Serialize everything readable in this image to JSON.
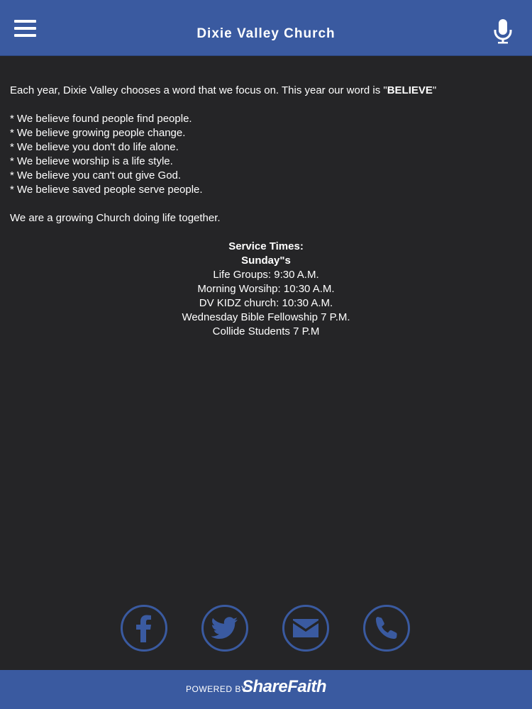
{
  "header": {
    "title": "Dixie Valley Church",
    "menu_icon": "hamburger-menu-icon",
    "mic_icon": "microphone-icon",
    "background_color": "#3a5aa0"
  },
  "content": {
    "intro_prefix": "Each year, Dixie Valley chooses a word that we focus on.  This year our word is \"",
    "intro_word": "BELIEVE",
    "intro_suffix": "\"",
    "beliefs": [
      "* We believe found people find people.",
      "* We believe growing people change.",
      "* We believe you don't do life alone.",
      "* We believe worship is a life style.",
      "* We believe you can't out give God.",
      "* We believe saved people serve people."
    ],
    "closing": "We are a growing Church doing life together."
  },
  "service": {
    "heading": "Service Times:",
    "day": "Sunday\"s",
    "times": [
      "Life Groups: 9:30 A.M.",
      "Morning Worsihp: 10:30 A.M.",
      "DV KIDZ church: 10:30 A.M.",
      "Wednesday Bible Fellowship 7 P.M.",
      "Collide Students 7 P.M"
    ]
  },
  "social": {
    "icons": [
      "facebook-icon",
      "twitter-icon",
      "email-icon",
      "phone-icon"
    ],
    "accent_color": "#3a5aa0"
  },
  "footer": {
    "powered_by": "POWERED BY",
    "brand": "ShareFaith"
  }
}
